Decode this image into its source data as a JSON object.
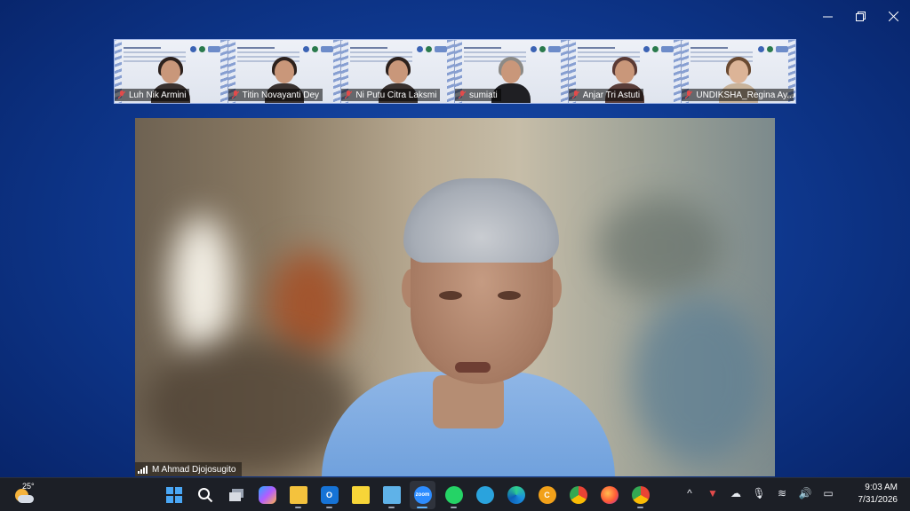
{
  "window": {
    "minimize_glyph": "—",
    "restore_glyph": "❐",
    "close_glyph": "✕"
  },
  "participants": [
    {
      "name": "Luh Nik Armini"
    },
    {
      "name": "Titin Novayanti Dey"
    },
    {
      "name": "Ni Putu Citra Laksmi"
    },
    {
      "name": "sumiati"
    },
    {
      "name": "Anjar Tri Astuti"
    },
    {
      "name": "UNDIKSHA_Regina Ay..."
    }
  ],
  "active_speaker": {
    "name": "M Ahmad Djojosugito"
  },
  "taskbar": {
    "weather_temp": "25°",
    "apps": [
      {
        "name": "windows-start-icon",
        "label": ""
      },
      {
        "name": "search-icon",
        "label": ""
      },
      {
        "name": "task-view-icon",
        "label": ""
      },
      {
        "name": "copilot-icon",
        "label": ""
      },
      {
        "name": "file-explorer-icon",
        "label": ""
      },
      {
        "name": "outlook-icon",
        "label": ""
      },
      {
        "name": "sticky-notes-icon",
        "label": ""
      },
      {
        "name": "notepad-icon",
        "label": ""
      },
      {
        "name": "zoom-icon",
        "label": "zoom"
      },
      {
        "name": "whatsapp-icon",
        "label": ""
      },
      {
        "name": "telegram-icon",
        "label": ""
      },
      {
        "name": "edge-icon",
        "label": ""
      },
      {
        "name": "cc-app-icon",
        "label": "C"
      },
      {
        "name": "chrome-icon",
        "label": ""
      },
      {
        "name": "firefox-icon",
        "label": ""
      },
      {
        "name": "chrome-profile-icon",
        "label": ""
      }
    ],
    "tray": {
      "chevron": "^",
      "time": "9:03 AM",
      "date": "7/31/2026"
    }
  },
  "colors": {
    "background": "#0f3a92",
    "taskbar": "#1c1f26",
    "shirt": "#8fb6e6"
  }
}
